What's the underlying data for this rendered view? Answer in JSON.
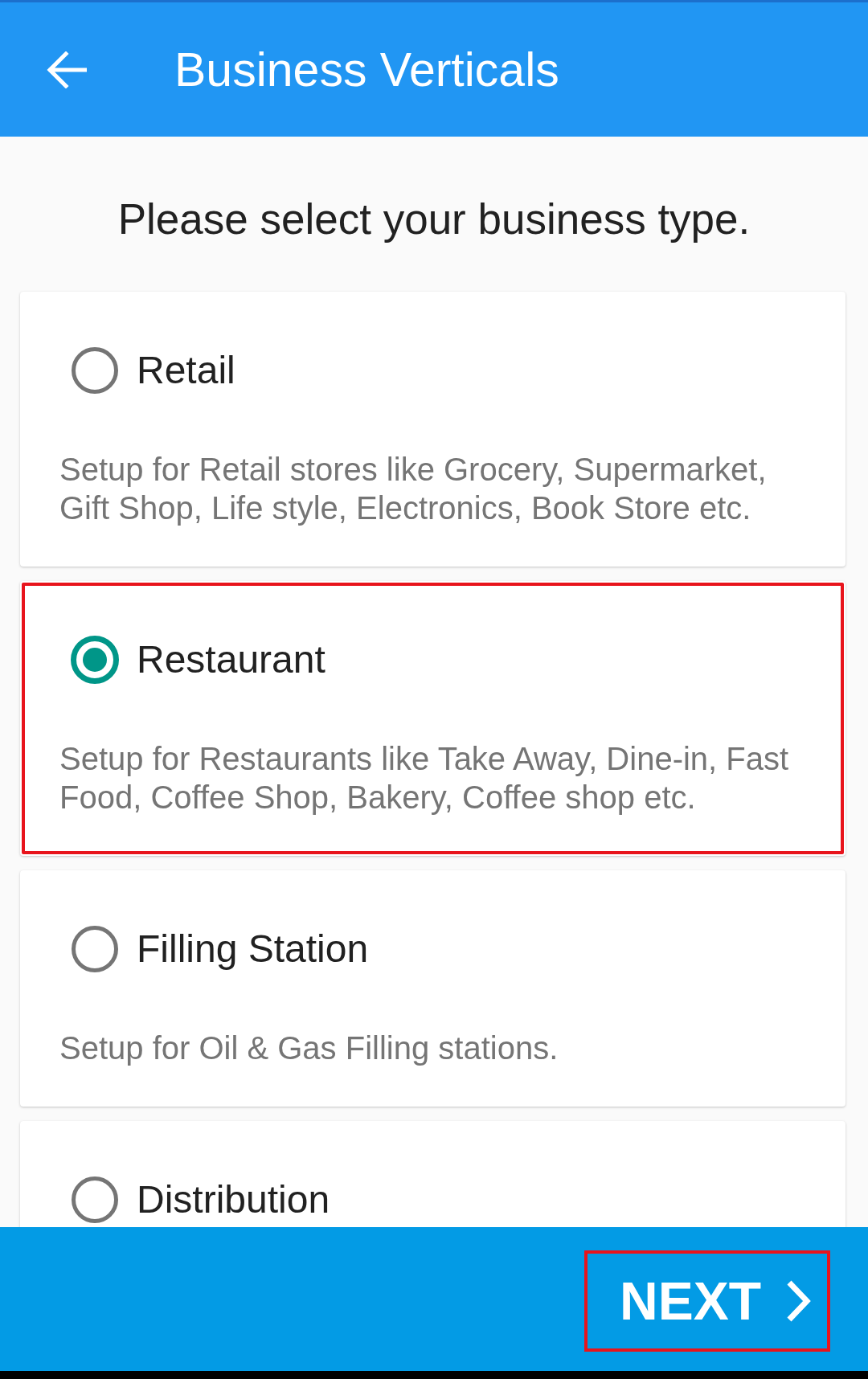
{
  "app_bar": {
    "title": "Business Verticals"
  },
  "prompt": "Please select your business type.",
  "options": [
    {
      "label": "Retail",
      "description": "Setup for Retail stores like Grocery, Supermarket, Gift Shop, Life style, Electronics, Book Store etc.",
      "selected": false,
      "highlighted": false
    },
    {
      "label": "Restaurant",
      "description": "Setup for Restaurants like Take Away, Dine-in, Fast Food, Coffee Shop, Bakery, Coffee shop etc.",
      "selected": true,
      "highlighted": true
    },
    {
      "label": "Filling Station",
      "description": "Setup for Oil & Gas Filling stations.",
      "selected": false,
      "highlighted": false
    },
    {
      "label": "Distribution",
      "selected": false,
      "highlighted": false
    }
  ],
  "footer": {
    "next_button": {
      "label": "NEXT",
      "highlighted": true
    }
  }
}
